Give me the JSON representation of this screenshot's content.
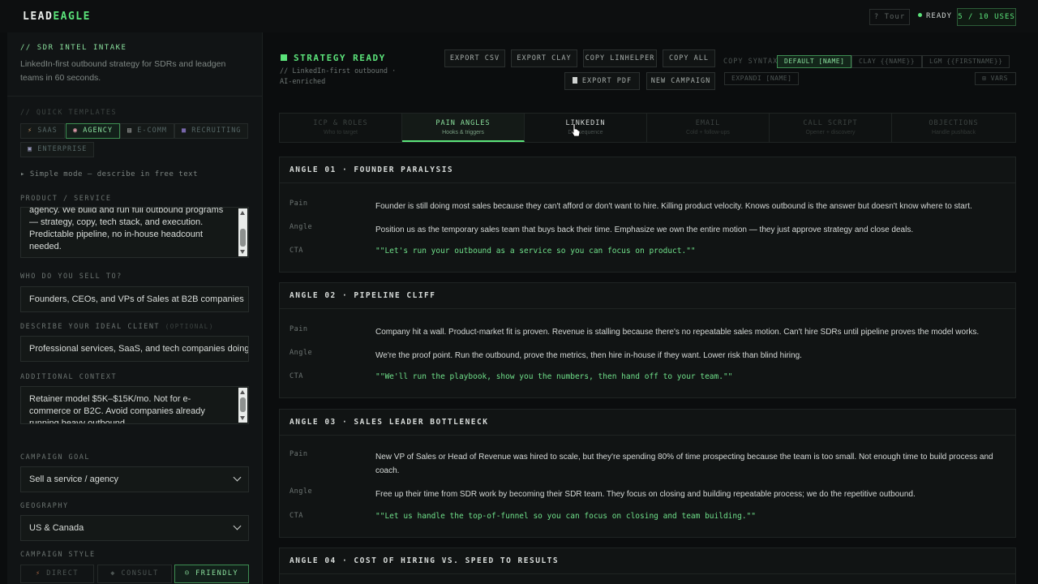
{
  "brand": {
    "prefix": "LEAD",
    "accent": "EAGLE",
    "accent_color": "#5be37a"
  },
  "topbar": {
    "tour_label": "? Tour",
    "status_label": "READY",
    "uses_label": "5 / 10 USES"
  },
  "sidebar": {
    "tag": "// SDR INTEL INTAKE",
    "description": "LinkedIn-first outbound strategy for SDRs and leadgen teams in 60 seconds.",
    "quick_templates_label": "// QUICK TEMPLATES",
    "templates": [
      {
        "icon": "⚡",
        "label": "SAAS"
      },
      {
        "icon": "◉",
        "label": "AGENCY"
      },
      {
        "icon": "▤",
        "label": "E-COMM"
      },
      {
        "icon": "■",
        "label": "RECRUITING"
      },
      {
        "icon": "▣",
        "label": "ENTERPRISE"
      }
    ],
    "simple_mode": "▸ Simple mode — describe in free text",
    "product_label": "PRODUCT / SERVICE",
    "product_value": "agency. We build and run full outbound programs — strategy, copy, tech stack, and execution. Predictable pipeline, no in-house headcount needed.",
    "who_label": "WHO DO YOU SELL TO?",
    "who_value": "Founders, CEOs, and VPs of Sales at B2B companies",
    "ideal_label": "DESCRIBE YOUR IDEAL CLIENT",
    "ideal_optional": "(OPTIONAL)",
    "ideal_value": "Professional services, SaaS, and tech companies doing",
    "context_label": "ADDITIONAL CONTEXT",
    "context_value": "Retainer model $5K–$15K/mo. Not for e-commerce or B2C. Avoid companies already running heavy outbound.",
    "goal_label": "CAMPAIGN GOAL",
    "goal_value": "Sell a service / agency",
    "geo_label": "GEOGRAPHY",
    "geo_value": "US & Canada",
    "style_label": "CAMPAIGN STYLE",
    "styles": [
      {
        "icon": "⚡",
        "label": "DIRECT"
      },
      {
        "icon": "◆",
        "label": "CONSULT"
      },
      {
        "icon": "☺",
        "label": "FRIENDLY"
      }
    ]
  },
  "main": {
    "status": "STRATEGY READY",
    "status_sub": "// LinkedIn-first outbound · AI-enriched",
    "buttons": {
      "export_csv": "EXPORT CSV",
      "export_clay": "EXPORT CLAY",
      "copy_linhelper": "COPY LINHELPER",
      "copy_all": "COPY ALL",
      "export_pdf": "EXPORT PDF",
      "new_campaign": "NEW CAMPAIGN"
    },
    "copy_syntax_label": "COPY SYNTAX:",
    "syntax_options": [
      "DEFAULT [NAME]",
      "CLAY {{NAME}}",
      "LGM {{FIRSTNAME}}",
      "EXPANDI [NAME]"
    ],
    "vars_label": "VARS",
    "tabs": [
      {
        "title": "ICP & ROLES",
        "sub": "Who to target"
      },
      {
        "title": "PAIN ANGLES",
        "sub": "Hooks & triggers"
      },
      {
        "title": "LINKEDIN",
        "sub": "DM sequence"
      },
      {
        "title": "EMAIL",
        "sub": "Cold + follow-ups"
      },
      {
        "title": "CALL SCRIPT",
        "sub": "Opener + discovery"
      },
      {
        "title": "OBJECTIONS",
        "sub": "Handle pushback"
      }
    ],
    "row_labels": {
      "pain": "Pain",
      "angle": "Angle",
      "cta": "CTA"
    },
    "angles": [
      {
        "title": "ANGLE 01 · FOUNDER PARALYSIS",
        "pain": "Founder is still doing most sales because they can't afford or don't want to hire. Killing product velocity. Knows outbound is the answer but doesn't know where to start.",
        "angle": "Position us as the temporary sales team that buys back their time. Emphasize we own the entire motion — they just approve strategy and close deals.",
        "cta": "\"\"Let's run your outbound as a service so you can focus on product.\"\""
      },
      {
        "title": "ANGLE 02 · PIPELINE CLIFF",
        "pain": "Company hit a wall. Product-market fit is proven. Revenue is stalling because there's no repeatable sales motion. Can't hire SDRs until pipeline proves the model works.",
        "angle": "We're the proof point. Run the outbound, prove the metrics, then hire in-house if they want. Lower risk than blind hiring.",
        "cta": "\"\"We'll run the playbook, show you the numbers, then hand off to your team.\"\""
      },
      {
        "title": "ANGLE 03 · SALES LEADER BOTTLENECK",
        "pain": "New VP of Sales or Head of Revenue was hired to scale, but they're spending 80% of time prospecting because the team is too small. Not enough time to build process and coach.",
        "angle": "Free up their time from SDR work by becoming their SDR team. They focus on closing and building repeatable process; we do the repetitive outbound.",
        "cta": "\"\"Let us handle the top-of-funnel so you can focus on closing and team building.\"\""
      },
      {
        "title": "ANGLE 04 · COST OF HIRING VS. SPEED TO RESULTS"
      }
    ]
  }
}
